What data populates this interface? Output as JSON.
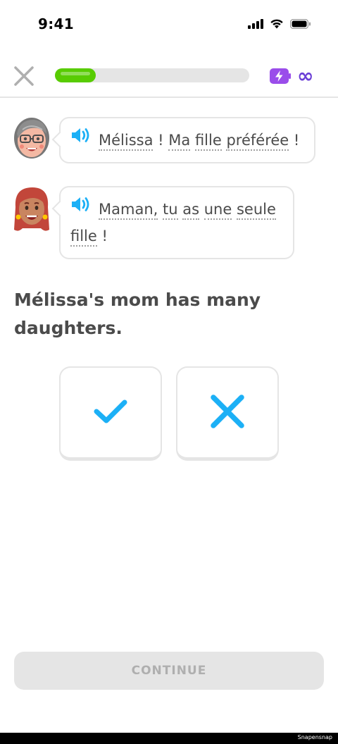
{
  "status_bar": {
    "time": "9:41"
  },
  "lesson": {
    "progress": 0.21,
    "energy": "∞"
  },
  "dialog": [
    {
      "speaker": "grandma-avatar",
      "words": [
        "Mélissa",
        "!",
        "Ma",
        "fille",
        "préférée",
        "!"
      ]
    },
    {
      "speaker": "melissa-avatar",
      "words": [
        "Maman,",
        "tu",
        "as",
        "une",
        "seule",
        "fille",
        "!"
      ]
    }
  ],
  "dialog_text": {
    "line1": {
      "w1": "Mélissa",
      "p1": " ! ",
      "w2": "Ma",
      "w3": "fille",
      "w4": "préférée",
      "p2": " !"
    },
    "line2": {
      "w1": "Maman,",
      "w2": "tu",
      "w3": "as",
      "w4": "une",
      "w5": "seule",
      "w6": "fille",
      "p1": " !"
    }
  },
  "prompt": "Mélissa's mom has many daughters.",
  "answers": {
    "true_icon": "check-icon",
    "false_icon": "x-icon"
  },
  "continue_label": "CONTINUE",
  "watermark": "Snapensnap",
  "colors": {
    "progress_green": "#58cc02",
    "accent_blue": "#1cb0f6",
    "energy_purple": "#9a4dea",
    "button_disabled": "#e5e5e5",
    "text": "#4b4b4b"
  }
}
